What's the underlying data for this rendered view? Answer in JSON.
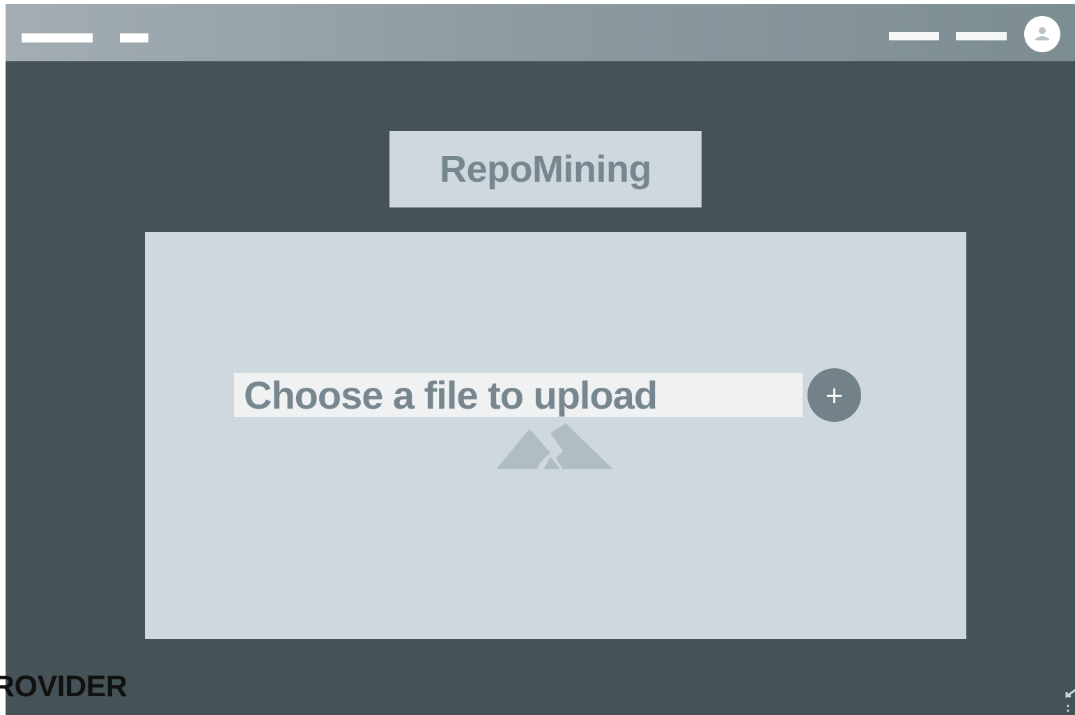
{
  "app": {
    "title": "RepoMining"
  },
  "upload": {
    "label": "Choose a file to upload",
    "add_button_glyph": "+"
  },
  "overlay": {
    "watermark_text": "ROVIDER"
  },
  "icons": {
    "avatar": "user-avatar-icon",
    "image_placeholder": "mountain-image-icon",
    "add": "plus-icon",
    "corner": "resize-arrow-icon"
  },
  "colors": {
    "background": "#455258",
    "panel": "#cfd8de",
    "accent": "#738188",
    "text_muted": "#78878f"
  }
}
